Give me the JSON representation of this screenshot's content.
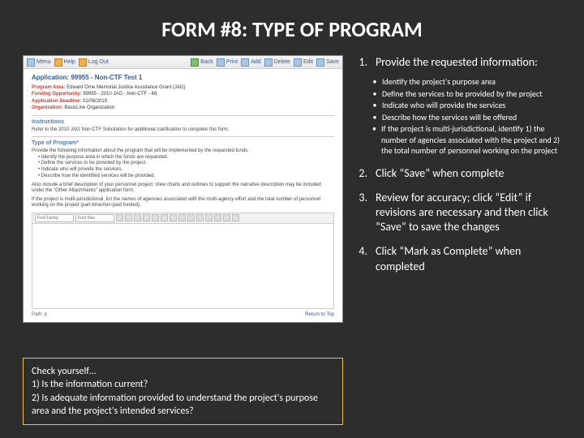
{
  "title": "FORM #8:  TYPE OF PROGRAM",
  "screenshot": {
    "toolbar": {
      "menu": "Menu",
      "help": "Help",
      "logout": "Log Out",
      "back": "Back",
      "print": "Print",
      "add": "Add",
      "delete": "Delete",
      "edit": "Edit",
      "save": "Save"
    },
    "app_title": "Application: 99955 - Non-CTF Test 1",
    "meta": {
      "program_area_label": "Program Area:",
      "program_area_value": "Edward Orne Memorial Justice Assistance Grant (JAG)",
      "funding_opp_label": "Funding Opportunity:",
      "funding_opp_value": "99955 - 2010 JAG - Non-CTF - 48;",
      "deadline_label": "Application Deadline:",
      "deadline_value": "01/06/2019",
      "org_label": "Organization:",
      "org_value": "BasicLine Organization"
    },
    "instructions_header": "Instructions",
    "instructions_text": "Refer to the 2010 JAG Non-CTF Solicitation for additional clarification to complete this form.",
    "type_header": "Type of Program*",
    "type_intro": "Provide the following information about the program that will be implemented by the requested funds:",
    "type_bullets": [
      "Identify the purpose area in which the funds are requested.",
      "Define the services to be provided by the project.",
      "Indicate who will provide the services.",
      "Describe how the identified services will be provided."
    ],
    "type_note1": "Also include a brief description of your personnel project. View charts and outlines to support the narrative description may be included under the \"Other Attachments\" application form.",
    "type_note2": "If the project is multi-jurisdictional, list the names of agencies associated with the multi-agency effort and the total number of personnel working on the project (part-time/non-paid funded).",
    "editor_sel1": "Font Family",
    "editor_sel2": "Font Size",
    "path_label": "Path: p",
    "return_top": "Return to Top"
  },
  "steps": [
    {
      "num": "1.",
      "text": "Provide the requested information:",
      "sub": [
        "Identify the project's purpose area",
        "Define the services to be provided by the project",
        "Indicate who will provide the services",
        "Describe how the services will be offered",
        "If the project is multi-jurisdictional, identify 1) the number of agencies associated with the project and 2) the total number of personnel working on the project"
      ]
    },
    {
      "num": "2.",
      "text": "Click “Save” when complete"
    },
    {
      "num": "3.",
      "text": "Review for accuracy; click “Edit” if revisions are necessary and then click “Save” to save the changes"
    },
    {
      "num": "4.",
      "text": "Click “Mark as Complete” when completed"
    }
  ],
  "checkbox": {
    "heading": "Check yourself…",
    "q1": "1) Is the information current?",
    "q2": "2) Is adequate information provided to understand the project's purpose area and the project's intended services?"
  }
}
